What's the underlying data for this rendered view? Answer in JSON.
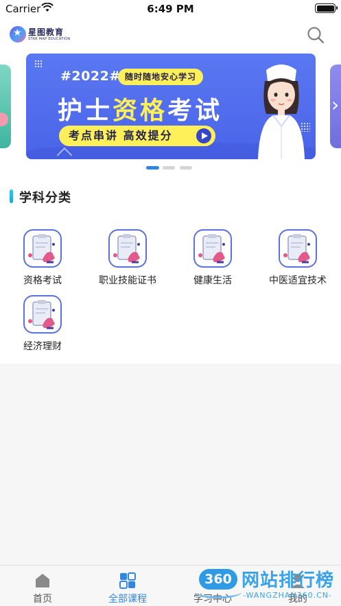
{
  "status_bar": {
    "carrier": "Carrier",
    "time": "6:49 PM"
  },
  "header": {
    "logo_cn": "星图教育",
    "logo_en": "STAR MAP EDUCATION",
    "search_icon": "search-icon"
  },
  "banner": {
    "year_tag": "#2022#",
    "slogan": "随时随地安心学习",
    "title_part1": "护士",
    "title_highlight": "资格",
    "title_part2": "考试",
    "subtitle": "考点串讲 高效提分",
    "active_page": 1,
    "page_count": 3,
    "colors": {
      "background": "#4f6bec",
      "accent": "#fff05a"
    }
  },
  "section": {
    "title": "学科分类"
  },
  "categories": [
    {
      "label": "资格考试",
      "icon": "clipboard-icon"
    },
    {
      "label": "职业技能证书",
      "icon": "clipboard-icon"
    },
    {
      "label": "健康生活",
      "icon": "clipboard-icon"
    },
    {
      "label": "中医适宜技术",
      "icon": "clipboard-icon"
    },
    {
      "label": "经济理财",
      "icon": "clipboard-icon"
    }
  ],
  "tabbar": {
    "items": [
      {
        "label": "首页",
        "icon": "home-icon",
        "active": false
      },
      {
        "label": "全部课程",
        "icon": "grid-icon",
        "active": true
      },
      {
        "label": "学习中心",
        "icon": "study-icon",
        "active": false
      },
      {
        "label": "我的",
        "icon": "profile-icon",
        "active": false
      }
    ],
    "active_color": "#2f86e6"
  },
  "watermark": {
    "badge": "360",
    "cn": "网站排行榜",
    "en": "-WANGZHAN360.CN-"
  }
}
